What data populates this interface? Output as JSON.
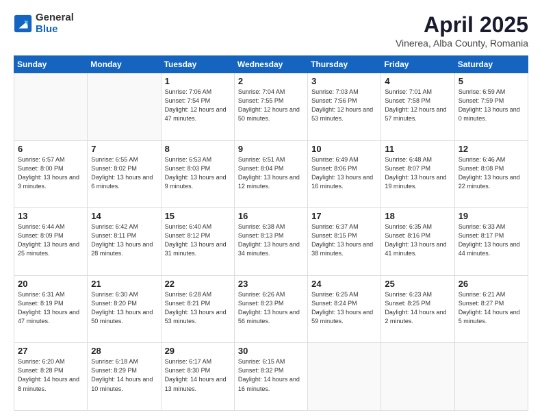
{
  "logo": {
    "general": "General",
    "blue": "Blue"
  },
  "header": {
    "month": "April 2025",
    "location": "Vinerea, Alba County, Romania"
  },
  "weekdays": [
    "Sunday",
    "Monday",
    "Tuesday",
    "Wednesday",
    "Thursday",
    "Friday",
    "Saturday"
  ],
  "weeks": [
    [
      {
        "day": "",
        "empty": true
      },
      {
        "day": "",
        "empty": true
      },
      {
        "day": "1",
        "info": "Sunrise: 7:06 AM\nSunset: 7:54 PM\nDaylight: 12 hours and 47 minutes."
      },
      {
        "day": "2",
        "info": "Sunrise: 7:04 AM\nSunset: 7:55 PM\nDaylight: 12 hours and 50 minutes."
      },
      {
        "day": "3",
        "info": "Sunrise: 7:03 AM\nSunset: 7:56 PM\nDaylight: 12 hours and 53 minutes."
      },
      {
        "day": "4",
        "info": "Sunrise: 7:01 AM\nSunset: 7:58 PM\nDaylight: 12 hours and 57 minutes."
      },
      {
        "day": "5",
        "info": "Sunrise: 6:59 AM\nSunset: 7:59 PM\nDaylight: 13 hours and 0 minutes."
      }
    ],
    [
      {
        "day": "6",
        "info": "Sunrise: 6:57 AM\nSunset: 8:00 PM\nDaylight: 13 hours and 3 minutes."
      },
      {
        "day": "7",
        "info": "Sunrise: 6:55 AM\nSunset: 8:02 PM\nDaylight: 13 hours and 6 minutes."
      },
      {
        "day": "8",
        "info": "Sunrise: 6:53 AM\nSunset: 8:03 PM\nDaylight: 13 hours and 9 minutes."
      },
      {
        "day": "9",
        "info": "Sunrise: 6:51 AM\nSunset: 8:04 PM\nDaylight: 13 hours and 12 minutes."
      },
      {
        "day": "10",
        "info": "Sunrise: 6:49 AM\nSunset: 8:06 PM\nDaylight: 13 hours and 16 minutes."
      },
      {
        "day": "11",
        "info": "Sunrise: 6:48 AM\nSunset: 8:07 PM\nDaylight: 13 hours and 19 minutes."
      },
      {
        "day": "12",
        "info": "Sunrise: 6:46 AM\nSunset: 8:08 PM\nDaylight: 13 hours and 22 minutes."
      }
    ],
    [
      {
        "day": "13",
        "info": "Sunrise: 6:44 AM\nSunset: 8:09 PM\nDaylight: 13 hours and 25 minutes."
      },
      {
        "day": "14",
        "info": "Sunrise: 6:42 AM\nSunset: 8:11 PM\nDaylight: 13 hours and 28 minutes."
      },
      {
        "day": "15",
        "info": "Sunrise: 6:40 AM\nSunset: 8:12 PM\nDaylight: 13 hours and 31 minutes."
      },
      {
        "day": "16",
        "info": "Sunrise: 6:38 AM\nSunset: 8:13 PM\nDaylight: 13 hours and 34 minutes."
      },
      {
        "day": "17",
        "info": "Sunrise: 6:37 AM\nSunset: 8:15 PM\nDaylight: 13 hours and 38 minutes."
      },
      {
        "day": "18",
        "info": "Sunrise: 6:35 AM\nSunset: 8:16 PM\nDaylight: 13 hours and 41 minutes."
      },
      {
        "day": "19",
        "info": "Sunrise: 6:33 AM\nSunset: 8:17 PM\nDaylight: 13 hours and 44 minutes."
      }
    ],
    [
      {
        "day": "20",
        "info": "Sunrise: 6:31 AM\nSunset: 8:19 PM\nDaylight: 13 hours and 47 minutes."
      },
      {
        "day": "21",
        "info": "Sunrise: 6:30 AM\nSunset: 8:20 PM\nDaylight: 13 hours and 50 minutes."
      },
      {
        "day": "22",
        "info": "Sunrise: 6:28 AM\nSunset: 8:21 PM\nDaylight: 13 hours and 53 minutes."
      },
      {
        "day": "23",
        "info": "Sunrise: 6:26 AM\nSunset: 8:23 PM\nDaylight: 13 hours and 56 minutes."
      },
      {
        "day": "24",
        "info": "Sunrise: 6:25 AM\nSunset: 8:24 PM\nDaylight: 13 hours and 59 minutes."
      },
      {
        "day": "25",
        "info": "Sunrise: 6:23 AM\nSunset: 8:25 PM\nDaylight: 14 hours and 2 minutes."
      },
      {
        "day": "26",
        "info": "Sunrise: 6:21 AM\nSunset: 8:27 PM\nDaylight: 14 hours and 5 minutes."
      }
    ],
    [
      {
        "day": "27",
        "info": "Sunrise: 6:20 AM\nSunset: 8:28 PM\nDaylight: 14 hours and 8 minutes."
      },
      {
        "day": "28",
        "info": "Sunrise: 6:18 AM\nSunset: 8:29 PM\nDaylight: 14 hours and 10 minutes."
      },
      {
        "day": "29",
        "info": "Sunrise: 6:17 AM\nSunset: 8:30 PM\nDaylight: 14 hours and 13 minutes."
      },
      {
        "day": "30",
        "info": "Sunrise: 6:15 AM\nSunset: 8:32 PM\nDaylight: 14 hours and 16 minutes."
      },
      {
        "day": "",
        "empty": true
      },
      {
        "day": "",
        "empty": true
      },
      {
        "day": "",
        "empty": true
      }
    ]
  ]
}
